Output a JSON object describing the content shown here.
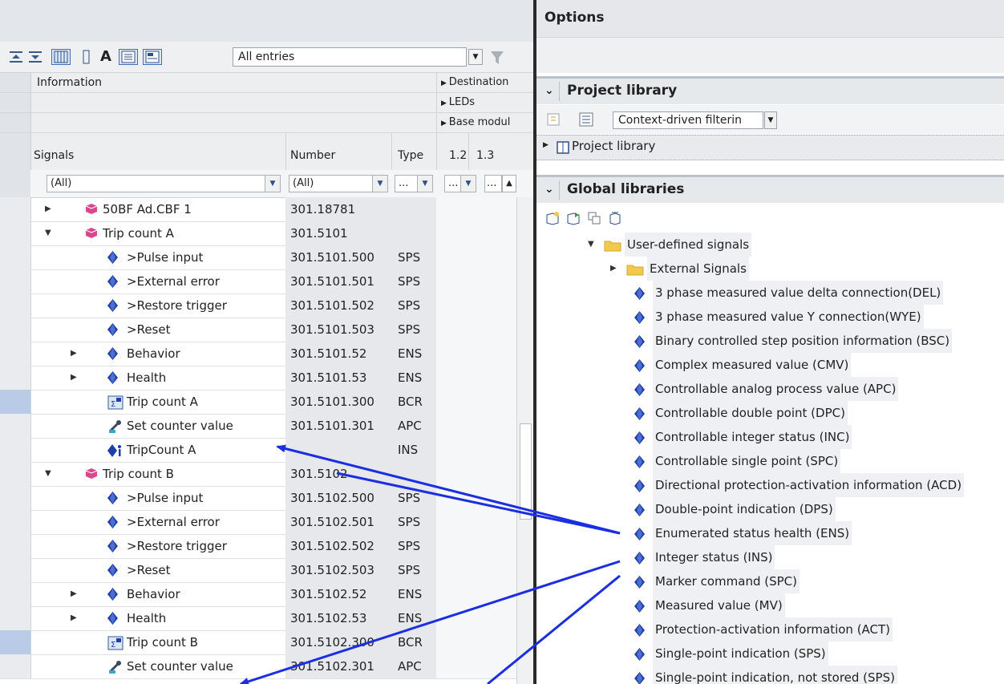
{
  "toolbar": {
    "filter_select": "All entries",
    "icons": [
      "expand-all-icon",
      "collapse-all-icon",
      "table-view-icon",
      "column-icon",
      "font-icon",
      "list-view-icon",
      "detail-view-icon",
      "filter-icon"
    ],
    "icon_a_label": "A"
  },
  "headers": {
    "information": "Information",
    "destination": "Destination",
    "leds": "LEDs",
    "base_module": "Base modul",
    "signals": "Signals",
    "number": "Number",
    "type": "Type",
    "col_1_2": "1.2",
    "col_1_3": "1.3"
  },
  "filters": {
    "signals": "(All)",
    "number": "(All)",
    "type": "...",
    "c1": "...",
    "c2": "..."
  },
  "rows": [
    {
      "name": "50BF Ad.CBF 1",
      "number": "301.18781",
      "type": "",
      "caret": "▶",
      "icon": "function-block-icon",
      "level": 0
    },
    {
      "name": "Trip count A",
      "number": "301.5101",
      "type": "",
      "caret": "▼",
      "icon": "function-block-icon",
      "level": 0
    },
    {
      "name": ">Pulse input",
      "number": "301.5101.500",
      "type": "SPS",
      "caret": "",
      "icon": "signal-diamond-icon",
      "level": 1
    },
    {
      "name": ">External error",
      "number": "301.5101.501",
      "type": "SPS",
      "caret": "",
      "icon": "signal-diamond-icon",
      "level": 1
    },
    {
      "name": ">Restore trigger",
      "number": "301.5101.502",
      "type": "SPS",
      "caret": "",
      "icon": "signal-diamond-icon",
      "level": 1
    },
    {
      "name": ">Reset",
      "number": "301.5101.503",
      "type": "SPS",
      "caret": "",
      "icon": "signal-diamond-icon",
      "level": 1
    },
    {
      "name": "Behavior",
      "number": "301.5101.52",
      "type": "ENS",
      "caret": "▶",
      "icon": "signal-diamond-icon",
      "level": 1
    },
    {
      "name": "Health",
      "number": "301.5101.53",
      "type": "ENS",
      "caret": "▶",
      "icon": "signal-diamond-icon",
      "level": 1
    },
    {
      "name": "Trip count A",
      "number": "301.5101.300",
      "type": "BCR",
      "caret": "",
      "icon": "counter-icon",
      "level": 1
    },
    {
      "name": "Set counter value",
      "number": "301.5101.301",
      "type": "APC",
      "caret": "",
      "icon": "wrench-icon",
      "level": 1
    },
    {
      "name": "TripCount A",
      "number": "",
      "type": "INS",
      "caret": "",
      "icon": "info-signal-icon",
      "level": 1
    },
    {
      "name": "Trip count B",
      "number": "301.5102",
      "type": "",
      "caret": "▼",
      "icon": "function-block-icon",
      "level": 0
    },
    {
      "name": ">Pulse input",
      "number": "301.5102.500",
      "type": "SPS",
      "caret": "",
      "icon": "signal-diamond-icon",
      "level": 1
    },
    {
      "name": ">External error",
      "number": "301.5102.501",
      "type": "SPS",
      "caret": "",
      "icon": "signal-diamond-icon",
      "level": 1
    },
    {
      "name": ">Restore trigger",
      "number": "301.5102.502",
      "type": "SPS",
      "caret": "",
      "icon": "signal-diamond-icon",
      "level": 1
    },
    {
      "name": ">Reset",
      "number": "301.5102.503",
      "type": "SPS",
      "caret": "",
      "icon": "signal-diamond-icon",
      "level": 1
    },
    {
      "name": "Behavior",
      "number": "301.5102.52",
      "type": "ENS",
      "caret": "▶",
      "icon": "signal-diamond-icon",
      "level": 1
    },
    {
      "name": "Health",
      "number": "301.5102.53",
      "type": "ENS",
      "caret": "▶",
      "icon": "signal-diamond-icon",
      "level": 1
    },
    {
      "name": "Trip count B",
      "number": "301.5102.300",
      "type": "BCR",
      "caret": "",
      "icon": "counter-icon",
      "level": 1
    },
    {
      "name": "Set counter value",
      "number": "301.5102.301",
      "type": "APC",
      "caret": "",
      "icon": "wrench-icon",
      "level": 1
    }
  ],
  "options": {
    "title": "Options",
    "project_library": {
      "title": "Project library",
      "filter": "Context-driven filterin",
      "tree_root": "Project library"
    },
    "global_libraries": {
      "title": "Global libraries",
      "tool_icons": [
        "open-library-icon",
        "update-library-icon",
        "save-library-icon",
        "close-library-icon"
      ],
      "tree": [
        {
          "label": "User-defined signals",
          "kind": "folder",
          "caret": "▼",
          "indent": 0
        },
        {
          "label": "External Signals",
          "kind": "folder",
          "caret": "▶",
          "indent": 1
        },
        {
          "label": "3 phase measured value delta connection(DEL)",
          "kind": "signal",
          "indent": 2
        },
        {
          "label": "3 phase measured value Y connection(WYE)",
          "kind": "signal",
          "indent": 2
        },
        {
          "label": "Binary controlled step position information (BSC)",
          "kind": "signal",
          "indent": 2
        },
        {
          "label": "Complex measured value (CMV)",
          "kind": "signal",
          "indent": 2
        },
        {
          "label": "Controllable analog process value (APC)",
          "kind": "signal",
          "indent": 2
        },
        {
          "label": "Controllable double point (DPC)",
          "kind": "signal",
          "indent": 2
        },
        {
          "label": "Controllable integer status (INC)",
          "kind": "signal",
          "indent": 2
        },
        {
          "label": "Controllable single point (SPC)",
          "kind": "signal",
          "indent": 2
        },
        {
          "label": "Directional protection-activation information (ACD)",
          "kind": "signal",
          "indent": 2
        },
        {
          "label": "Double-point indication (DPS)",
          "kind": "signal",
          "indent": 2
        },
        {
          "label": "Enumerated status health (ENS)",
          "kind": "signal",
          "indent": 2
        },
        {
          "label": "Integer status (INS)",
          "kind": "signal",
          "indent": 2
        },
        {
          "label": "Marker command (SPC)",
          "kind": "signal",
          "indent": 2
        },
        {
          "label": "Measured value (MV)",
          "kind": "signal",
          "indent": 2
        },
        {
          "label": "Protection-activation information (ACT)",
          "kind": "signal",
          "indent": 2
        },
        {
          "label": "Single-point indication (SPS)",
          "kind": "signal",
          "indent": 2
        },
        {
          "label": "Single-point indication, not stored (SPS)",
          "kind": "signal",
          "indent": 2
        }
      ]
    }
  },
  "colors": {
    "signal_blue": "#1f3fa8",
    "folder_yellow": "#f2c94c",
    "function_pink": "#d9478f",
    "arrow_blue": "#1b2fe0"
  }
}
